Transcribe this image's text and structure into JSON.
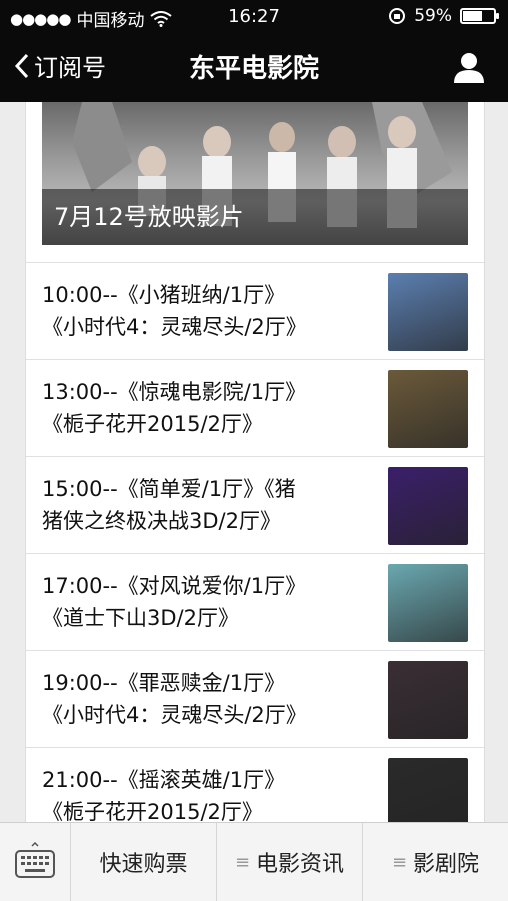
{
  "status": {
    "carrier": "中国移动",
    "time": "16:27",
    "battery": "59%",
    "battery_level": 0.59
  },
  "nav": {
    "back_label": "订阅号",
    "title": "东平电影院"
  },
  "banner": {
    "caption": "7月12号放映影片"
  },
  "schedule": [
    {
      "line1": "10:00--《小猪班纳/1厅》",
      "line2": "《小时代4：灵魂尽头/2厅》",
      "poster_color": "#5b7fb0"
    },
    {
      "line1": "13:00--《惊魂电影院/1厅》",
      "line2": "《栀子花开2015/2厅》",
      "poster_color": "#6b5a3a"
    },
    {
      "line1": "15:00--《简单爱/1厅》《猪",
      "line2": "猪侠之终极决战3D/2厅》",
      "poster_color": "#3b1f6a"
    },
    {
      "line1": "17:00--《对风说爱你/1厅》",
      "line2": "《道士下山3D/2厅》",
      "poster_color": "#6aa8b0"
    },
    {
      "line1": "19:00--《罪恶赎金/1厅》",
      "line2": "《小时代4：灵魂尽头/2厅》",
      "poster_color": "#3a2e34"
    },
    {
      "line1": "21:00--《摇滚英雄/1厅》",
      "line2": "《栀子花开2015/2厅》",
      "poster_color": "#2a2a2a"
    }
  ],
  "menu": {
    "item1": "快速购票",
    "item2": "电影资讯",
    "item3": "影剧院"
  }
}
